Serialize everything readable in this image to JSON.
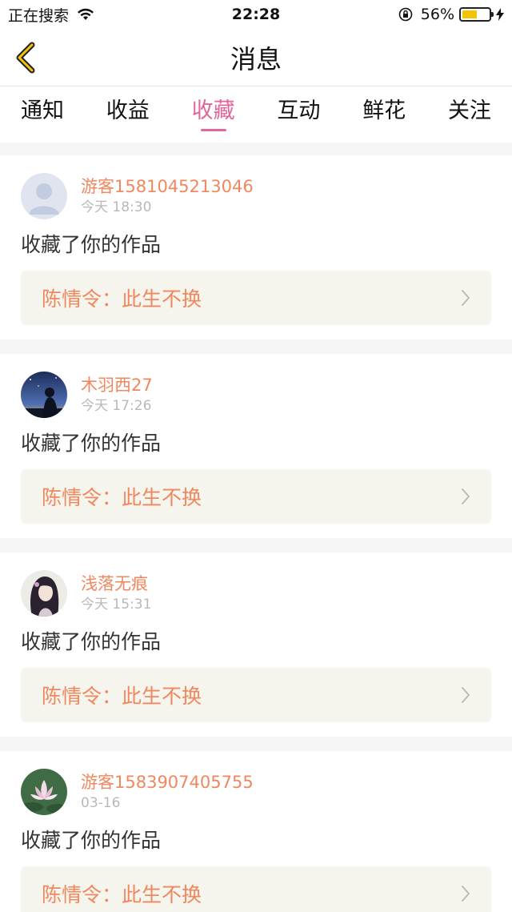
{
  "status_bar": {
    "carrier": "正在搜索",
    "time": "22:28",
    "battery": "56%",
    "battery_level": 0.56
  },
  "nav": {
    "title": "消息",
    "back_icon": "chevron-left-icon"
  },
  "tabs": [
    {
      "label": "通知",
      "active": false
    },
    {
      "label": "收益",
      "active": false
    },
    {
      "label": "收藏",
      "active": true
    },
    {
      "label": "互动",
      "active": false
    },
    {
      "label": "鲜花",
      "active": false
    },
    {
      "label": "关注",
      "active": false
    }
  ],
  "colors": {
    "accent_pink": "#e2659b",
    "accent_orange": "#f0875e"
  },
  "messages": [
    {
      "username": "游客1581045213046",
      "time": "今天 18:30",
      "action": "收藏了你的作品",
      "work": "陈情令：此生不换",
      "avatar": "default-avatar"
    },
    {
      "username": "木羽西27",
      "time": "今天 17:26",
      "action": "收藏了你的作品",
      "work": "陈情令：此生不换",
      "avatar": "night-silhouette-avatar"
    },
    {
      "username": "浅落无痕",
      "time": "今天 15:31",
      "action": "收藏了你的作品",
      "work": "陈情令：此生不换",
      "avatar": "anime-girl-avatar"
    },
    {
      "username": "游客1583907405755",
      "time": "03-16",
      "action": "收藏了你的作品",
      "work": "陈情令：此生不换",
      "avatar": "lotus-avatar"
    }
  ]
}
